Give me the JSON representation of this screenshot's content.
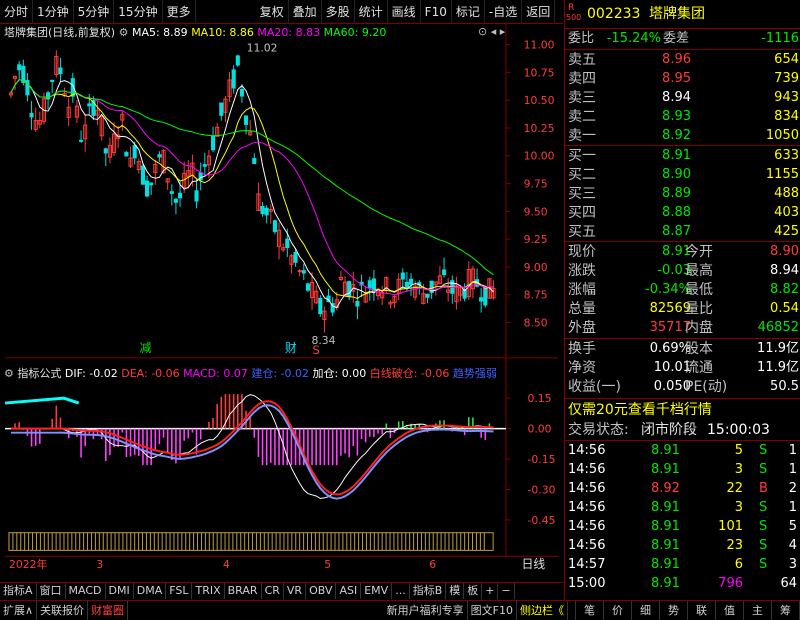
{
  "toolbar": {
    "periods": [
      "分时",
      "1分钟",
      "5分钟",
      "15分钟",
      "更多"
    ],
    "tools": [
      "复权",
      "叠加",
      "多股",
      "统计",
      "画线",
      "F10",
      "标记",
      "-自选",
      "返回"
    ]
  },
  "chart_header": {
    "title": "塔牌集团(日线,前复权)",
    "ma5": "MA5: 8.89",
    "ma10": "MA10: 8.86",
    "ma20": "MA20: 8.83",
    "ma60": "MA60: 9.20"
  },
  "price_axis": [
    "11.00",
    "10.75",
    "10.50",
    "10.25",
    "10.00",
    "9.75",
    "9.50",
    "9.25",
    "9.00",
    "8.75",
    "8.50"
  ],
  "annotations": {
    "high": "11.02",
    "low": "8.34",
    "jian": "减",
    "cai": "财",
    "s": "S"
  },
  "indicator_header": {
    "name": "指标公式",
    "dif": "DIF: -0.02",
    "dea": "DEA: -0.06",
    "macd": "MACD: 0.07",
    "jiacang1": "建仓: -0.02",
    "jiacang2": "加仓: 0.00",
    "baixian": "白线破仓: -0.06",
    "trend": "趋势强弱"
  },
  "ind_axis": [
    "0.15",
    "0.00",
    "-0.15",
    "-0.30",
    "-0.45"
  ],
  "x_axis": [
    "2022年",
    "3",
    "4",
    "5",
    "6",
    "日线"
  ],
  "tabs1": [
    "指标A",
    "窗口",
    "MACD",
    "DMI",
    "DMA",
    "FSL",
    "TRIX",
    "BRAR",
    "CR",
    "VR",
    "OBV",
    "ASI",
    "EMV",
    "...",
    "指标B",
    "模",
    "板",
    "+",
    "−"
  ],
  "tabs2": [
    "扩展∧",
    "关联报价",
    "财富圈"
  ],
  "tabs2_right": [
    "新用户福利专享",
    "图文F10",
    "侧边栏《"
  ],
  "side_tabs": [
    "笔",
    "价",
    "细",
    "势",
    "联",
    "值",
    "主",
    "筹"
  ],
  "stock": {
    "code": "002233",
    "name": "塔牌集团",
    "badge_r": "R",
    "badge_num": "500",
    "webi": "委比",
    "webi_val": "-15.24%",
    "weicha": "委差",
    "weicha_val": "-1116",
    "sell": [
      {
        "label": "卖五",
        "price": "8.96",
        "vol": "654"
      },
      {
        "label": "卖四",
        "price": "8.95",
        "vol": "739"
      },
      {
        "label": "卖三",
        "price": "8.94",
        "vol": "943"
      },
      {
        "label": "卖二",
        "price": "8.93",
        "vol": "834"
      },
      {
        "label": "卖一",
        "price": "8.92",
        "vol": "1050"
      }
    ],
    "buy": [
      {
        "label": "买一",
        "price": "8.91",
        "vol": "633"
      },
      {
        "label": "买二",
        "price": "8.90",
        "vol": "1155"
      },
      {
        "label": "买三",
        "price": "8.89",
        "vol": "488"
      },
      {
        "label": "买四",
        "price": "8.88",
        "vol": "403"
      },
      {
        "label": "买五",
        "price": "8.87",
        "vol": "425"
      }
    ],
    "quote": [
      {
        "l1": "现价",
        "v1": "8.91",
        "l2": "今开",
        "v2": "8.90"
      },
      {
        "l1": "涨跌",
        "v1": "-0.03",
        "l2": "最高",
        "v2": "8.94"
      },
      {
        "l1": "涨幅",
        "v1": "-0.34%",
        "l2": "最低",
        "v2": "8.82"
      },
      {
        "l1": "总量",
        "v1": "82569",
        "l2": "量比",
        "v2": "0.54"
      },
      {
        "l1": "外盘",
        "v1": "35717",
        "l2": "内盘",
        "v2": "46852"
      }
    ],
    "fund": [
      {
        "l1": "换手",
        "v1": "0.69%",
        "l2": "股本",
        "v2": "11.9亿"
      },
      {
        "l1": "净资",
        "v1": "10.01",
        "l2": "流通",
        "v2": "11.9亿"
      },
      {
        "l1": "收益(一)",
        "v1": "0.050",
        "l2": "PE(动)",
        "v2": "50.5"
      }
    ],
    "promo": "仅需20元查看千档行情",
    "status_label": "交易状态:",
    "status_val": "闭市阶段",
    "status_time": "15:00:03",
    "ticks": [
      {
        "t": "14:56",
        "p": "8.91",
        "v": "5",
        "d": "S",
        "n": "1"
      },
      {
        "t": "14:56",
        "p": "8.91",
        "v": "3",
        "d": "S",
        "n": "1"
      },
      {
        "t": "14:56",
        "p": "8.92",
        "v": "22",
        "d": "B",
        "n": "2"
      },
      {
        "t": "14:56",
        "p": "8.91",
        "v": "3",
        "d": "S",
        "n": "1"
      },
      {
        "t": "14:56",
        "p": "8.91",
        "v": "101",
        "d": "S",
        "n": "5"
      },
      {
        "t": "14:56",
        "p": "8.91",
        "v": "23",
        "d": "S",
        "n": "4"
      },
      {
        "t": "14:57",
        "p": "8.91",
        "v": "6",
        "d": "S",
        "n": "3"
      },
      {
        "t": "15:00",
        "p": "8.91",
        "v": "796",
        "d": "",
        "n": "64"
      }
    ]
  },
  "colors": {
    "up": "#ff3c3c",
    "down": "#00e0e0",
    "ma5": "#ffffff",
    "ma10": "#ffff00",
    "ma20": "#ff00ff",
    "ma60": "#00ff00"
  }
}
